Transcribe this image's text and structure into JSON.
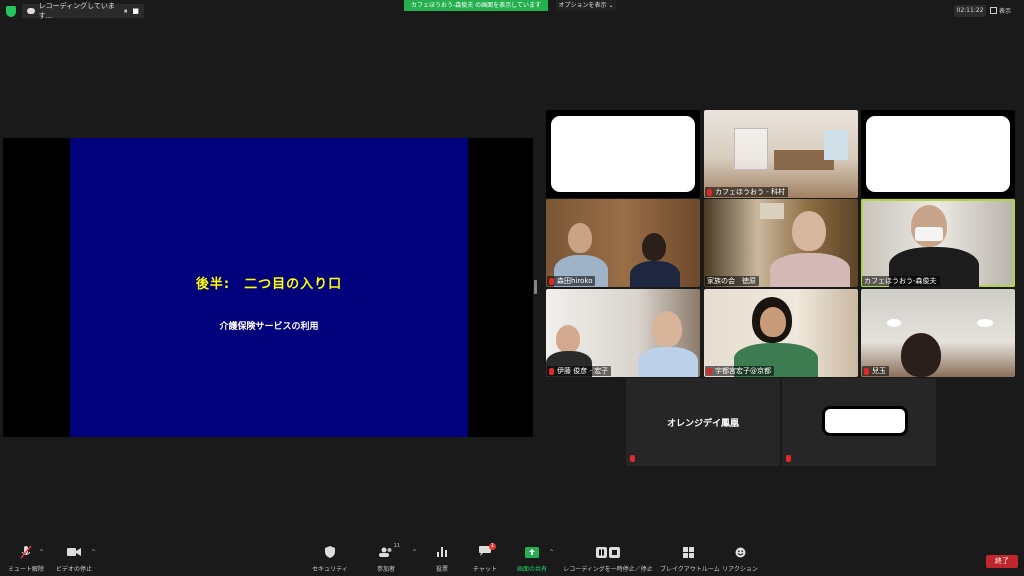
{
  "topbar": {
    "recording_label": "レコーディングしています...",
    "pause_symbol": "⏸",
    "stop_symbol": "■",
    "share_banner": "カフェほうおう-森俊夫 の画面を表示しています",
    "options_label": "オプションを表示",
    "options_caret": "⌄",
    "timer": "02:11:22",
    "view_label": "表示"
  },
  "slide": {
    "title": "後半:　二つ目の入り口",
    "subtitle": "介護保険サービスの利用"
  },
  "tiles": [
    {
      "name": ""
    },
    {
      "name": "カフェほうおう - 科村"
    },
    {
      "name": ""
    },
    {
      "name": "森田hiroko"
    },
    {
      "name": "家族の会　徳原"
    },
    {
      "name": "カフェほうおう-森俊夫"
    },
    {
      "name": "伊藤 俊彦 - 宏子"
    },
    {
      "name": "宇都宮宏子@京都"
    },
    {
      "name": "兒玉"
    }
  ],
  "name_tiles": [
    {
      "name": "オレンジデイ鳳凰"
    },
    {
      "name": ""
    }
  ],
  "toolbar": {
    "mute": "ミュート解除",
    "video": "ビデオの停止",
    "security": "セキュリティ",
    "participants": "参加者",
    "participants_count": "11",
    "polls": "投票",
    "chat": "チャット",
    "chat_badge": "1",
    "share": "画面の共有",
    "record": "レコーディングを一時停止／停止",
    "breakout": "ブレイクアウトルーム",
    "reactions": "リアクション",
    "end": "終了",
    "caret": "^"
  },
  "colors": {
    "share_green": "#25b04f",
    "slide_blue": "#01017c",
    "slide_title_yellow": "#ffff00",
    "end_red": "#c0272d",
    "active_speaker": "#b4d445"
  }
}
